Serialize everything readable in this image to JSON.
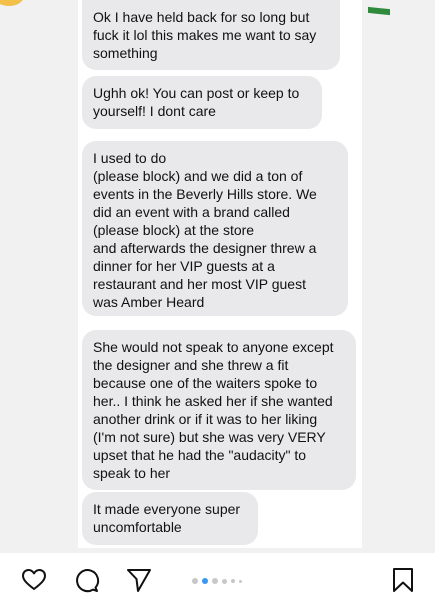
{
  "messages": [
    {
      "text": "Ok I have held back for so long but\nfuck it lol this makes me want to say\nsomething"
    },
    {
      "text": "Ughh ok! You can post or keep to\nyourself! I dont care"
    },
    {
      "text": "I used to do\n(please block) and we did a ton of\nevents in the Beverly Hills store. We\ndid an event with a brand called\n              (please block) at the store\nand afterwards the designer threw a\ndinner for her VIP guests at a\nrestaurant and her most VIP guest\nwas Amber Heard"
    },
    {
      "text": "She would not speak to anyone except\nthe designer and she threw a fit\nbecause one of the waiters spoke to\nher.. I think he asked her if she wanted\nanother drink or if it was to her liking\n(I'm not sure) but she was very VERY\nupset that he had the \"audacity\" to\nspeak to her"
    },
    {
      "text": "It made everyone super\nuncomfortable"
    }
  ],
  "action_bar": {
    "icons": [
      "heart-icon",
      "comment-icon",
      "share-icon",
      "bookmark-icon"
    ],
    "carousel": {
      "total_dots": 6,
      "active_index": 1
    }
  },
  "colors": {
    "bubble": "#e9e9eb",
    "background": "#f1f1f1",
    "active_dot": "#3897f0",
    "inactive_dot": "#c7c7c7"
  }
}
